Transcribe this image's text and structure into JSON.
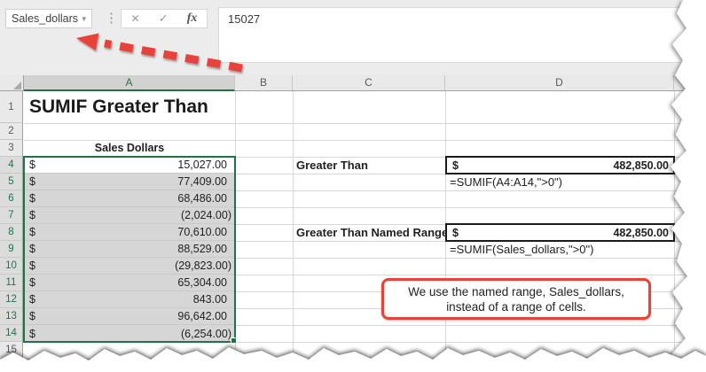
{
  "toolbar": {
    "name_box": "Sales_dollars",
    "dropdown_icon": "▾",
    "dots_icon": "⋮",
    "cancel_icon": "✕",
    "enter_icon": "✓",
    "fx_icon": "fx",
    "formula_bar": "15027"
  },
  "grid": {
    "columns": [
      "A",
      "B",
      "C",
      "D"
    ],
    "rows": [
      "1",
      "2",
      "3",
      "4",
      "5",
      "6",
      "7",
      "8",
      "9",
      "10",
      "11",
      "12",
      "13",
      "14",
      "15"
    ]
  },
  "sheet": {
    "title": "SUMIF Greater Than"
  },
  "sales": {
    "header": "Sales Dollars",
    "currency": "$",
    "values": [
      "15,027.00",
      "77,409.00",
      "68,486.00",
      "(2,024.00)",
      "70,610.00",
      "88,529.00",
      "(29,823.00)",
      "65,304.00",
      "843.00",
      "96,642.00",
      "(6,254.00)"
    ]
  },
  "greater_than": {
    "label": "Greater Than",
    "currency": "$",
    "result": "482,850.00",
    "formula": "=SUMIF(A4:A14,\">0\")"
  },
  "named_range": {
    "label": "Greater Than Named Range",
    "currency": "$",
    "result": "482,850.00",
    "formula": "=SUMIF(Sales_dollars,\">0\")"
  },
  "callout": {
    "line1": "We use the named range, Sales_dollars,",
    "line2": "instead of a range of cells."
  },
  "colors": {
    "excel_green": "#217346",
    "arrow_red": "#e8423b",
    "selection_fill": "#d6d6d6"
  }
}
